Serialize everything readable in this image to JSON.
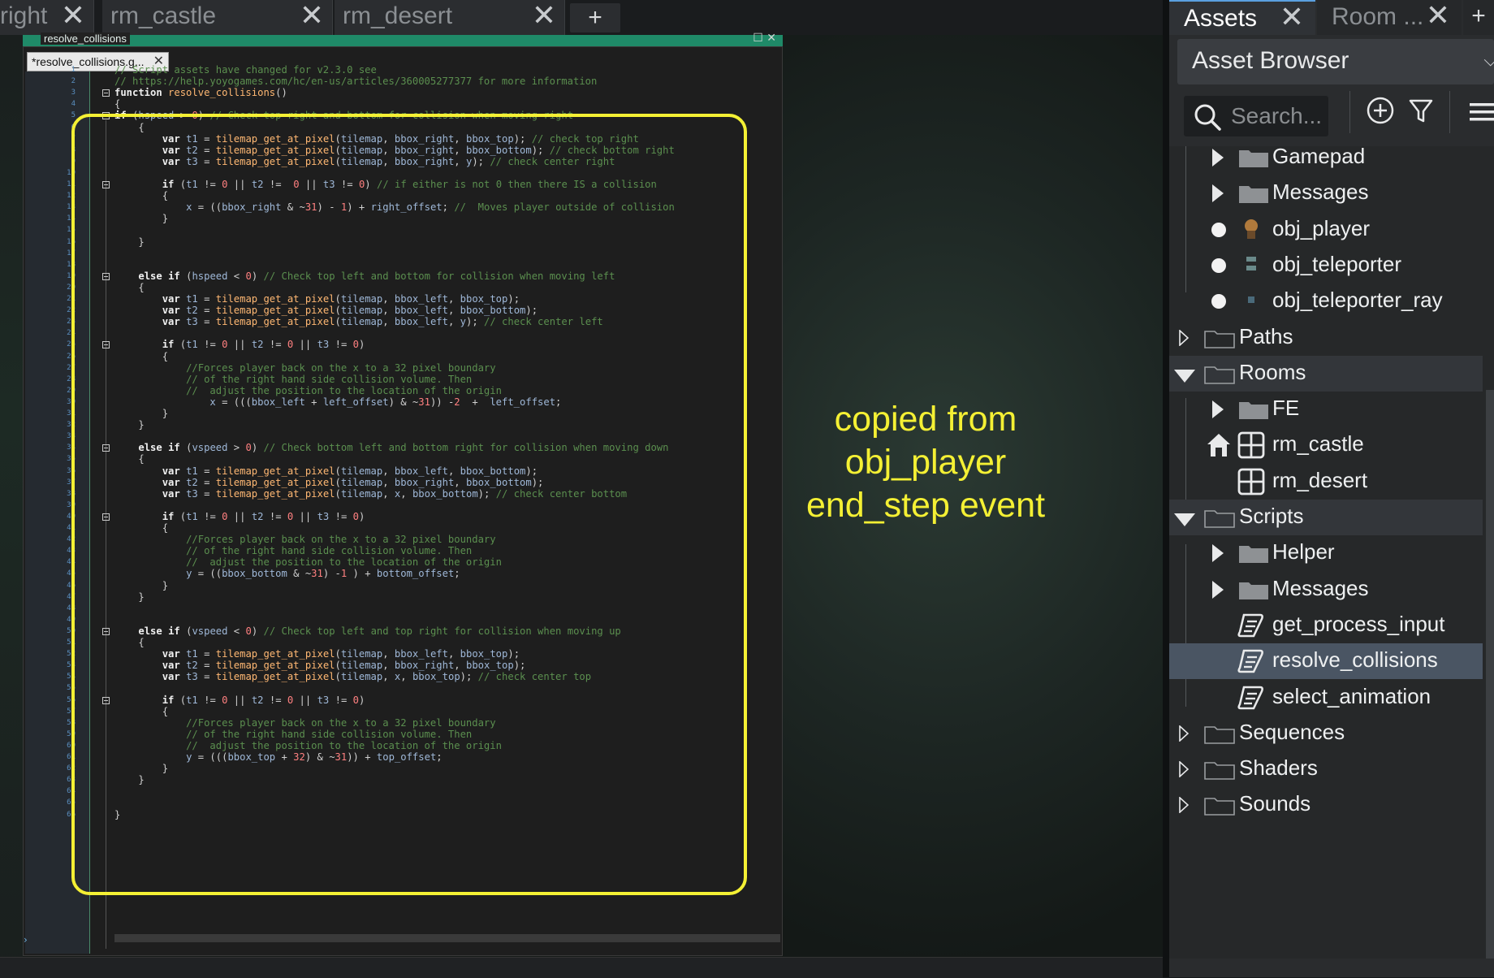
{
  "top_tabs": [
    {
      "label": "right"
    },
    {
      "label": "rm_castle"
    },
    {
      "label": "rm_desert"
    }
  ],
  "top_add_label": "+",
  "window": {
    "title": "resolve_collisions",
    "code_tab_label": "*resolve_collisions.g..."
  },
  "code_lines": [
    "// Script assets have changed for v2.3.0 see",
    "// https://help.yoyogames.com/hc/en-us/articles/360005277377 for more information",
    "function resolve_collisions()",
    "{",
    "if (hspeed > 0) // Check top right and bottom for collision when moving right",
    "    {",
    "        var t1 = tilemap_get_at_pixel(tilemap, bbox_right, bbox_top); // check top right",
    "        var t2 = tilemap_get_at_pixel(tilemap, bbox_right, bbox_bottom); // check bottom right",
    "        var t3 = tilemap_get_at_pixel(tilemap, bbox_right, y); // check center right",
    "",
    "        if (t1 != 0 || t2 !=  0 || t3 != 0) // if either is not 0 then there IS a collision",
    "        {",
    "            x = ((bbox_right & ~31) - 1) + right_offset; //  Moves player outside of collision",
    "        }",
    "",
    "    }",
    "",
    "",
    "    else if (hspeed < 0) // Check top left and bottom for collision when moving left",
    "    {",
    "        var t1 = tilemap_get_at_pixel(tilemap, bbox_left, bbox_top);",
    "        var t2 = tilemap_get_at_pixel(tilemap, bbox_left, bbox_bottom);",
    "        var t3 = tilemap_get_at_pixel(tilemap, bbox_left, y); // check center left",
    "",
    "        if (t1 != 0 || t2 != 0 || t3 != 0)",
    "        {",
    "            //Forces player back on the x to a 32 pixel boundary",
    "            // of the right hand side collision volume. Then",
    "            //  adjust the position to the location of the origin",
    "                x = (((bbox_left + left_offset) & ~31)) -2  +  left_offset;",
    "        }",
    "    }",
    "",
    "    else if (vspeed > 0) // Check bottom left and bottom right for collision when moving down",
    "    {",
    "        var t1 = tilemap_get_at_pixel(tilemap, bbox_left, bbox_bottom);",
    "        var t2 = tilemap_get_at_pixel(tilemap, bbox_right, bbox_bottom);",
    "        var t3 = tilemap_get_at_pixel(tilemap, x, bbox_bottom); // check center bottom",
    "",
    "        if (t1 != 0 || t2 != 0 || t3 != 0)",
    "        {",
    "            //Forces player back on the x to a 32 pixel boundary",
    "            // of the right hand side collision volume. Then",
    "            //  adjust the position to the location of the origin",
    "            y = ((bbox_bottom & ~31) -1 ) + bottom_offset;",
    "        }",
    "    }",
    "",
    "",
    "    else if (vspeed < 0) // Check top left and top right for collision when moving up",
    "    {",
    "        var t1 = tilemap_get_at_pixel(tilemap, bbox_left, bbox_top);",
    "        var t2 = tilemap_get_at_pixel(tilemap, bbox_right, bbox_top);",
    "        var t3 = tilemap_get_at_pixel(tilemap, x, bbox_top); // check center top",
    "",
    "        if (t1 != 0 || t2 != 0 || t3 != 0)",
    "        {",
    "            //Forces player back on the x to a 32 pixel boundary",
    "            // of the right hand side collision volume. Then",
    "            //  adjust the position to the location of the origin",
    "            y = (((bbox_top + 32) & ~31)) + top_offset;",
    "        }",
    "    }",
    "",
    "",
    "}"
  ],
  "annotation": {
    "lines": [
      "copied from",
      "obj_player",
      "end_step event"
    ],
    "color": "#f4f034"
  },
  "right_panel": {
    "tabs": [
      {
        "label": "Assets"
      },
      {
        "label": "Room ..."
      }
    ],
    "add_label": "+",
    "header_title": "Asset Browser",
    "search_placeholder": "Search...",
    "tree": [
      {
        "label": "Gamepad",
        "type": "folder",
        "state": "collapsed"
      },
      {
        "label": "Messages",
        "type": "folder",
        "state": "collapsed"
      },
      {
        "label": "obj_player",
        "type": "object"
      },
      {
        "label": "obj_teleporter",
        "type": "object"
      },
      {
        "label": "obj_teleporter_ray",
        "type": "object"
      },
      {
        "label": "Paths",
        "type": "group",
        "state": "collapsed"
      },
      {
        "label": "Rooms",
        "type": "group",
        "state": "expanded"
      },
      {
        "label": "FE",
        "type": "folder",
        "state": "collapsed"
      },
      {
        "label": "rm_castle",
        "type": "room",
        "home": true
      },
      {
        "label": "rm_desert",
        "type": "room"
      },
      {
        "label": "Scripts",
        "type": "group",
        "state": "expanded"
      },
      {
        "label": "Helper",
        "type": "folder",
        "state": "collapsed"
      },
      {
        "label": "Messages",
        "type": "folder",
        "state": "collapsed"
      },
      {
        "label": "get_process_input",
        "type": "script"
      },
      {
        "label": "resolve_collisions",
        "type": "script",
        "selected": true
      },
      {
        "label": "select_animation",
        "type": "script"
      },
      {
        "label": "Sequences",
        "type": "group",
        "state": "collapsed"
      },
      {
        "label": "Shaders",
        "type": "group",
        "state": "collapsed"
      },
      {
        "label": "Sounds",
        "type": "group",
        "state": "collapsed"
      }
    ]
  },
  "colors": {
    "accent": "#1f8a68",
    "highlight": "#f4f034",
    "selection": "#4a5563"
  }
}
